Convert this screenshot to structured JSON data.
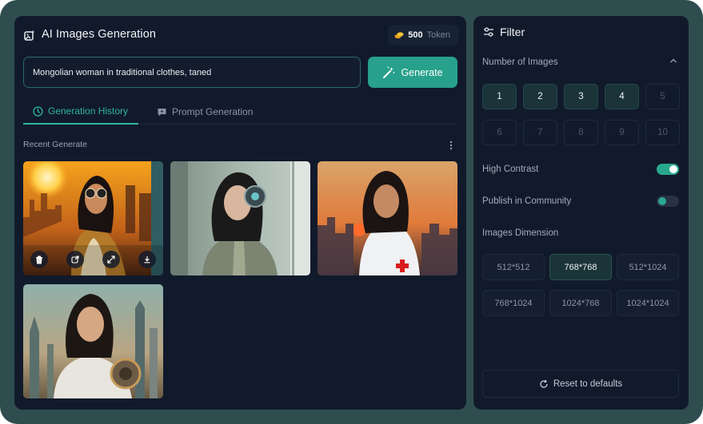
{
  "app": {
    "title": "AI Images Generation",
    "token_count": "500",
    "token_unit": "Token"
  },
  "prompt": {
    "value": "Mongolian woman in traditional clothes, taned",
    "generate_label": "Generate"
  },
  "tabs": [
    {
      "label": "Generation History",
      "active": true
    },
    {
      "label": "Prompt Generation",
      "active": false
    }
  ],
  "recent": {
    "label": "Recent Generate",
    "images": [
      {
        "name": "woman-sunglasses-city-sunset",
        "actions": [
          "trash-icon",
          "share-icon",
          "expand-icon",
          "download-icon"
        ]
      },
      {
        "name": "woman-headphones-window"
      },
      {
        "name": "woman-white-jacket-sunset"
      },
      {
        "name": "woman-astronaut-city"
      }
    ]
  },
  "filter": {
    "title": "Filter",
    "number_of_images": {
      "label": "Number of Images",
      "options": [
        "1",
        "2",
        "3",
        "4",
        "5",
        "6",
        "7",
        "8",
        "9",
        "10"
      ],
      "enabled_count": 4
    },
    "high_contrast": {
      "label": "High Contrast",
      "on": true
    },
    "publish_in_community": {
      "label": "Publish in Community",
      "on": false
    },
    "dimension": {
      "label": "Images Dimension",
      "options": [
        "512*512",
        "768*768",
        "512*1024",
        "768*1024",
        "1024*768",
        "1024*1024"
      ],
      "selected": "768*768"
    },
    "reset_label": "Reset to defaults"
  },
  "colors": {
    "accent": "#27a18b",
    "panel": "#111a2b",
    "frame": "#2f4d4f"
  }
}
